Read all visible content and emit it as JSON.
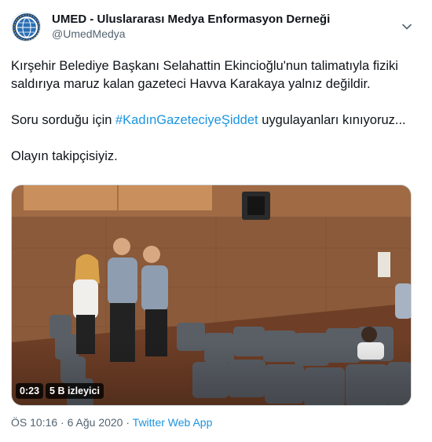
{
  "author": {
    "name": "UMED - Uluslararası Medya Enformasyon Derneği",
    "handle": "@UmedMedya"
  },
  "tweet": {
    "paragraph1": "Kırşehir Belediye Başkanı Selahattin Ekincioğlu'nun talimatıyla fiziki saldırıya maruz kalan gazeteci Havva Karakaya yalnız değildir.",
    "paragraph2_before": "Soru sorduğu için ",
    "hashtag": "#KadınGazeteciyeŞiddet",
    "paragraph2_after": " uygulayanları kınıyoruz...",
    "paragraph3": "Olayın takipçisiyiz."
  },
  "video": {
    "duration": "0:23",
    "views": "5 B izleyici"
  },
  "meta": {
    "time": "ÖS 10:16",
    "separator": " · ",
    "date": "6 Ağu 2020",
    "source_separator": " · ",
    "source": "Twitter Web App"
  },
  "icons": {
    "avatar": "umed-logo-icon",
    "caret": "chevron-down-icon"
  },
  "colors": {
    "link": "#1b95e0",
    "secondary_text": "#536471"
  }
}
